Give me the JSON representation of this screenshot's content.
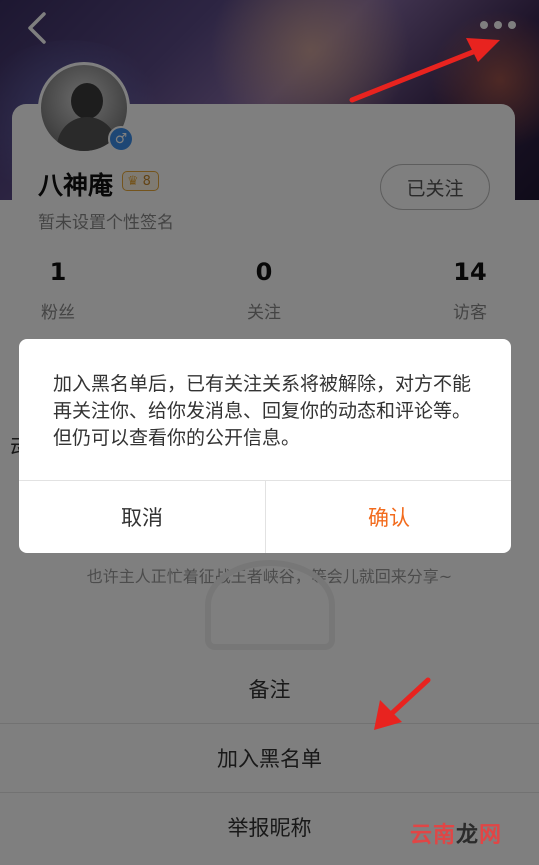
{
  "header": {
    "back_icon": "chevron-left-icon",
    "more_icon": "more-dots-icon"
  },
  "profile": {
    "name": "八神庵",
    "level": "8",
    "signature": "暂未设置个性签名",
    "follow_label": "已关注",
    "stats": [
      {
        "value": "1",
        "label": "粉丝"
      },
      {
        "value": "0",
        "label": "关注"
      },
      {
        "value": "14",
        "label": "访客"
      }
    ]
  },
  "content": {
    "side_glyph": "动",
    "empty_text": "也许主人正忙着征战王者峡谷，等会儿就回来分享~"
  },
  "action_sheet": {
    "items": [
      "备注",
      "加入黑名单",
      "举报昵称"
    ]
  },
  "dialog": {
    "message": "加入黑名单后，已有关注关系将被解除，对方不能再关注你、给你发消息、回复你的动态和评论等。但仍可以查看你的公开信息。",
    "cancel_label": "取消",
    "confirm_label": "确认"
  },
  "colors": {
    "accent": "#f26b1d",
    "arrow": "#e8231f",
    "gender": "#3d8eea",
    "level": "#e8a93a"
  },
  "watermark": {
    "part1": "云南",
    "part2": "龙",
    "part3": "网"
  }
}
